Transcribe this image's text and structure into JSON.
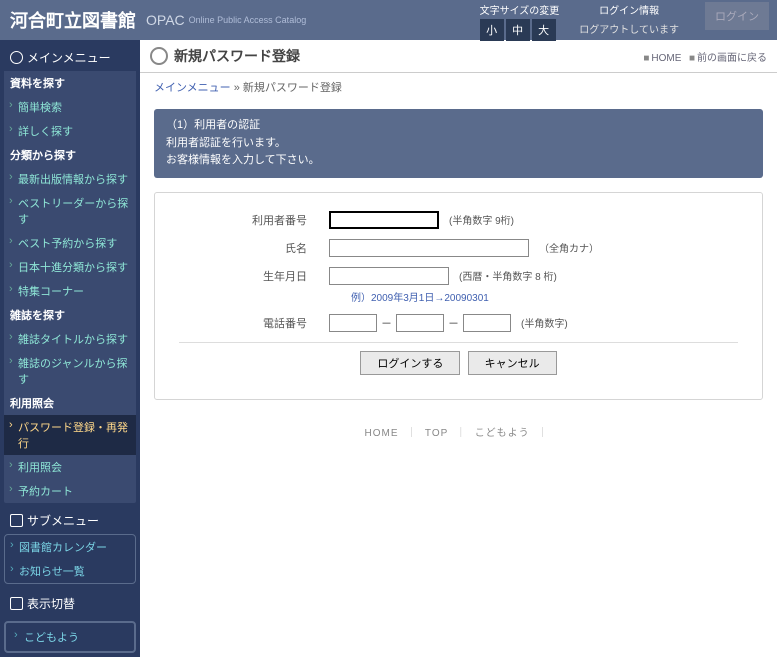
{
  "header": {
    "site_title": "河合町立図書館",
    "opac": "OPAC",
    "opac_sub": "Online Public Access Catalog",
    "font_label": "文字サイズの変更",
    "font_small": "小",
    "font_mid": "中",
    "font_large": "大",
    "login_label": "ログイン情報",
    "login_status": "ログアウトしています",
    "login_btn": "ログイン"
  },
  "sidebar": {
    "main_title": "メインメニュー",
    "groups": [
      {
        "header": "資料を探す",
        "items": [
          "簡単検索",
          "詳しく探す"
        ]
      },
      {
        "header": "分類から探す",
        "items": [
          "最新出版情報から探す",
          "ベストリーダーから探す",
          "ベスト予約から探す",
          "日本十進分類から探す",
          "特集コーナー"
        ]
      },
      {
        "header": "雑誌を探す",
        "items": [
          "雑誌タイトルから探す",
          "雑誌のジャンルから探す"
        ]
      },
      {
        "header": "利用照会",
        "items": [
          "パスワード登録・再発行",
          "利用照会",
          "予約カート"
        ],
        "active_index": 0
      }
    ],
    "sub_title": "サブメニュー",
    "sub_items": [
      "図書館カレンダー",
      "お知らせ一覧"
    ],
    "disp_title": "表示切替",
    "kids": "こどもよう"
  },
  "page": {
    "title": "新規パスワード登録",
    "home_link": "HOME",
    "back_link": "前の画面に戻る"
  },
  "breadcrumb": {
    "root": "メインメニュー",
    "sep": "»",
    "current": "新規パスワード登録"
  },
  "info": {
    "line1": "（1）利用者の認証",
    "line2": "利用者認証を行います。",
    "line3": "お客様情報を入力して下さい。"
  },
  "form": {
    "user_no_label": "利用者番号",
    "user_no_hint": "(半角数字 9桁)",
    "name_label": "氏名",
    "name_hint": "（全角カナ）",
    "birth_label": "生年月日",
    "birth_hint": "(西暦・半角数字 8 桁)",
    "birth_example": "例）2009年3月1日→20090301",
    "tel_label": "電話番号",
    "tel_sep": "－",
    "tel_hint": "(半角数字)",
    "submit": "ログインする",
    "cancel": "キャンセル"
  },
  "footer": {
    "home": "HOME",
    "top": "TOP",
    "kids": "こどもよう",
    "sep": "｜"
  }
}
